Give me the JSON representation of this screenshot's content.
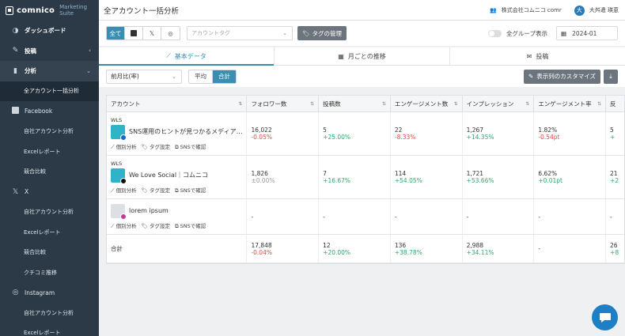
{
  "brand": {
    "name": "comnico",
    "suite": "Marketing Suite"
  },
  "sidebar": {
    "items": [
      {
        "label": "ダッシュボード",
        "icon": "dashboard-icon",
        "glyph": "◑"
      },
      {
        "label": "投稿",
        "icon": "pencil-icon",
        "glyph": "✎"
      },
      {
        "label": "分析",
        "icon": "bar-chart-icon",
        "glyph": "▮"
      },
      {
        "label": "全アカウント一括分析"
      },
      {
        "label": "Facebook",
        "icon": "facebook-icon"
      },
      {
        "label": "自社アカウント分析"
      },
      {
        "label": "Excelレポート"
      },
      {
        "label": "競合比較"
      },
      {
        "label": "X",
        "icon": "x-icon"
      },
      {
        "label": "自社アカウント分析"
      },
      {
        "label": "Excelレポート"
      },
      {
        "label": "競合比較"
      },
      {
        "label": "クチコミ推移"
      },
      {
        "label": "Instagram",
        "icon": "instagram-icon"
      },
      {
        "label": "自社アカウント分析"
      },
      {
        "label": "Excelレポート"
      }
    ]
  },
  "header": {
    "title": "全アカウント一括分析",
    "company": "株式会社コムニコ comr",
    "user_initial": "大",
    "user_name": "大舛遣 瑛恵"
  },
  "filters": {
    "platforms": [
      "全て",
      "f",
      "𝕏",
      "◎"
    ],
    "tag_placeholder": "アカウントタグ",
    "tag_manage": "タグの管理",
    "all_groups": "全グループ表示",
    "date": "2024-01"
  },
  "tabs": [
    {
      "label": "基本データ",
      "icon": "line-chart-icon"
    },
    {
      "label": "月ごとの推移",
      "icon": "calendar-icon"
    },
    {
      "label": "投稿",
      "icon": "comment-icon"
    }
  ],
  "controls": {
    "period": "前月比(率)",
    "avg": "平均",
    "total": "合計",
    "customize": "表示列のカスタマイズ"
  },
  "table": {
    "headers": [
      "アカウント",
      "フォロワー数",
      "投稿数",
      "エンゲージメント数",
      "インプレッション",
      "エンゲージメント率",
      "反"
    ],
    "link_labels": [
      "個別分析",
      "タグ設定",
      "SNSで確認"
    ],
    "rows": [
      {
        "label": "WLS",
        "name": "SNS運用のヒントが見つかるメディア…",
        "avatar_color": "#2fb3c7",
        "badge_color": "#1b64c8",
        "cells": [
          {
            "value": "16,022",
            "diff": "-0.05%",
            "tone": "neg"
          },
          {
            "value": "5",
            "diff": "+25.00%",
            "tone": "pos"
          },
          {
            "value": "22",
            "diff": "-8.33%",
            "tone": "neg"
          },
          {
            "value": "1,267",
            "diff": "+14.35%",
            "tone": "pos"
          },
          {
            "value": "1.82%",
            "diff": "-0.54pt",
            "tone": "neg"
          },
          {
            "value": "5",
            "diff": "+",
            "tone": "pos"
          }
        ]
      },
      {
        "label": "WLS",
        "name": "We Love Social｜コムニコ",
        "avatar_color": "#2fb3c7",
        "badge_color": "#111111",
        "cells": [
          {
            "value": "1,826",
            "diff": "±0.00%",
            "tone": "zero"
          },
          {
            "value": "7",
            "diff": "+16.67%",
            "tone": "pos"
          },
          {
            "value": "114",
            "diff": "+54.05%",
            "tone": "pos"
          },
          {
            "value": "1,721",
            "diff": "+53.66%",
            "tone": "pos"
          },
          {
            "value": "6.62%",
            "diff": "+0.01pt",
            "tone": "pos"
          },
          {
            "value": "21",
            "diff": "+2",
            "tone": "pos"
          }
        ]
      },
      {
        "label": "",
        "name": "lorem ipsum",
        "avatar_color": "#dcdfe3",
        "badge_color": "#c23a9e",
        "cells": [
          {
            "value": "-",
            "diff": "",
            "tone": "zero"
          },
          {
            "value": "-",
            "diff": "",
            "tone": "zero"
          },
          {
            "value": "-",
            "diff": "",
            "tone": "zero"
          },
          {
            "value": "-",
            "diff": "",
            "tone": "zero"
          },
          {
            "value": "-",
            "diff": "",
            "tone": "zero"
          },
          {
            "value": "-",
            "diff": "",
            "tone": "zero"
          }
        ]
      }
    ],
    "total": {
      "label": "合計",
      "cells": [
        {
          "value": "17,848",
          "diff": "-0.04%",
          "tone": "neg"
        },
        {
          "value": "12",
          "diff": "+20.00%",
          "tone": "pos"
        },
        {
          "value": "136",
          "diff": "+38.78%",
          "tone": "pos"
        },
        {
          "value": "2,988",
          "diff": "+34.11%",
          "tone": "pos"
        },
        {
          "value": "-",
          "diff": "",
          "tone": "zero"
        },
        {
          "value": "26",
          "diff": "+8",
          "tone": "pos"
        }
      ]
    }
  },
  "colors": {
    "accent": "#3a8fb0",
    "sidebar": "#2c3a47",
    "positive": "#2fa86e",
    "negative": "#e04a4a"
  }
}
